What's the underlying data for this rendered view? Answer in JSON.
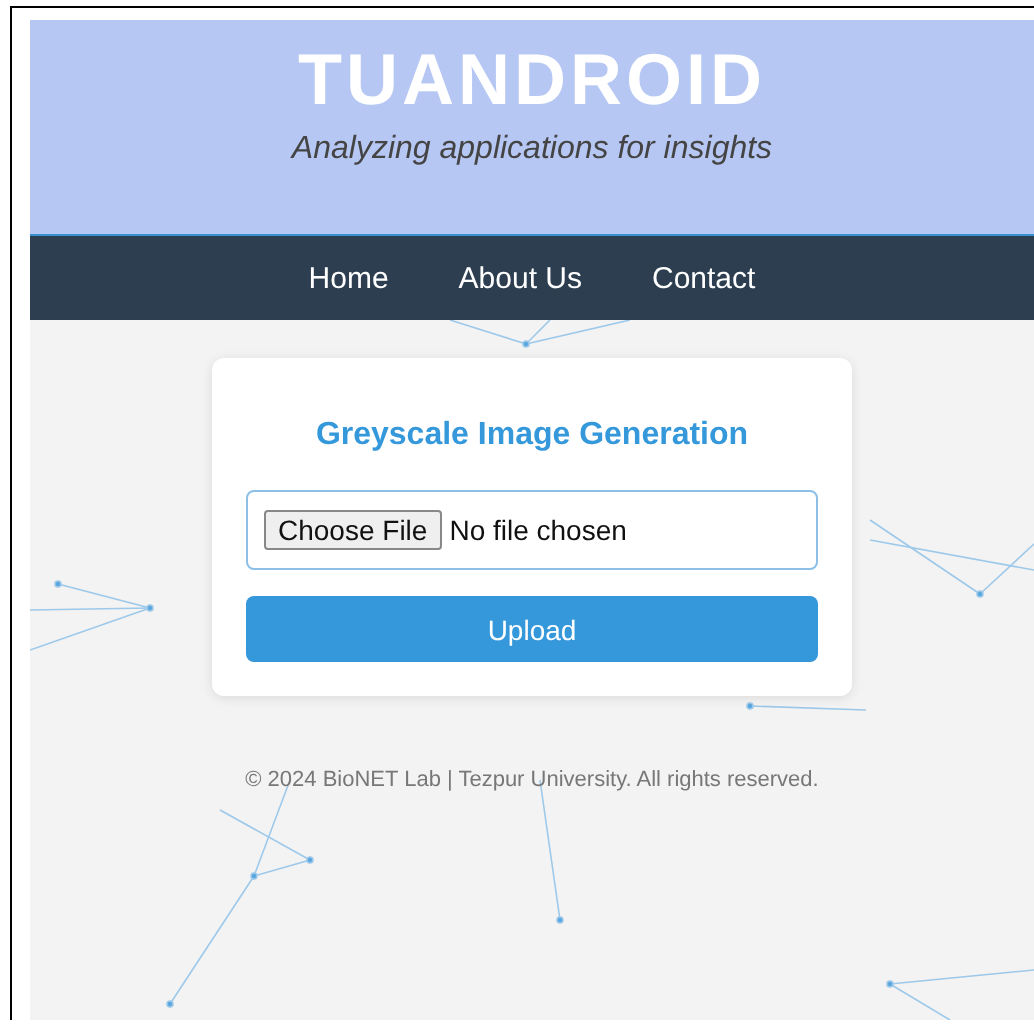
{
  "header": {
    "title": "TUANDROID",
    "tagline": "Analyzing applications for insights"
  },
  "nav": [
    {
      "label": "Home"
    },
    {
      "label": "About Us"
    },
    {
      "label": "Contact"
    }
  ],
  "card": {
    "title": "Greyscale Image Generation",
    "file_button": "Choose File",
    "file_status": "No file chosen",
    "submit": "Upload"
  },
  "footer": "© 2024 BioNET Lab | Tezpur University. All rights reserved."
}
